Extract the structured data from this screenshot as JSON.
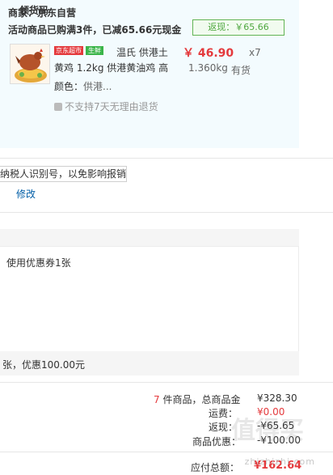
{
  "order": {
    "merchant": "商家：京东自营",
    "promo_text": "活动商品已购满3件，已减65.66元现金",
    "promo_tag": "返现：￥65.66",
    "product": {
      "badge_jd": "京东超市",
      "badge_green": "生鲜",
      "name_line1": "温氏 供港土",
      "name_line2": "黄鸡 1.2kg 供港黄油鸡 高",
      "price": "￥ 46.90",
      "qty": "x7",
      "weight": "1.360kg",
      "stock": "有货",
      "color_label": "颜色：",
      "color_value": "供港...",
      "return_policy": "不支持7天无理由退货"
    }
  },
  "invoice": {
    "hint": "纳税人识别号，以免影响报销",
    "edit_label": "修改"
  },
  "coupon": {
    "head_label": "领货码",
    "use_text": "使用优惠券1张",
    "foot_text": "张，优惠100.00元"
  },
  "totals": {
    "count": "7",
    "count_suffix": " 件商品，总商品金",
    "total_amount": "¥328.30",
    "freight_label": "运费：",
    "freight_value": "¥0.00",
    "refund_label": "返现：",
    "refund_value": "-¥65.65",
    "coupon_label": "商品优惠：",
    "coupon_value": "-¥100.00",
    "payable_label": "应付总额：",
    "payable_value": "¥162.64"
  },
  "watermark": {
    "text": "zhizhizhi.com",
    "logo": "值得买"
  },
  "colors": {
    "accent_red": "#e4393c",
    "accent_green": "#4fa740",
    "panel_bg": "#f3fbfe",
    "link_blue": "#005ea7"
  }
}
